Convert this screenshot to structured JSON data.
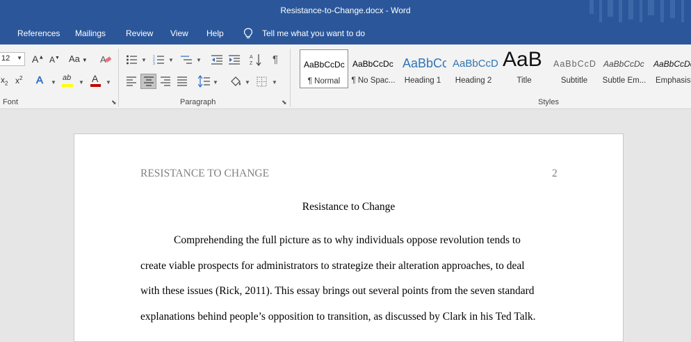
{
  "window": {
    "title": "Resistance-to-Change.docx  -  Word"
  },
  "menu": {
    "items": [
      "References",
      "Mailings",
      "Review",
      "View",
      "Help"
    ],
    "tell_me": "Tell me what you want to do"
  },
  "ribbon": {
    "font": {
      "label": "Font",
      "size": "12",
      "grow": "A",
      "shrink": "A",
      "change_case": "Aa",
      "subscript": "x",
      "superscript": "x",
      "text_effects": "A",
      "highlight": "ab",
      "font_color": "A"
    },
    "paragraph": {
      "label": "Paragraph",
      "pilcrow": "¶"
    },
    "styles": {
      "label": "Styles",
      "items": [
        {
          "preview": "AaBbCcDc",
          "name": "¶ Normal"
        },
        {
          "preview": "AaBbCcDc",
          "name": "¶ No Spac..."
        },
        {
          "preview": "AaBbCc",
          "name": "Heading 1"
        },
        {
          "preview": "AaBbCcD",
          "name": "Heading 2"
        },
        {
          "preview": "AaB",
          "name": "Title"
        },
        {
          "preview": "AaBbCcD",
          "name": "Subtitle"
        },
        {
          "preview": "AaBbCcDc",
          "name": "Subtle Em..."
        },
        {
          "preview": "AaBbCcDc",
          "name": "Emphasis"
        }
      ]
    },
    "colors": {
      "highlight": "#ffff00",
      "font_color": "#c00000"
    }
  },
  "document": {
    "header": "RESISTANCE TO CHANGE",
    "page_number": "2",
    "title": "Resistance to Change",
    "lines": [
      "Comprehending the full picture as to why individuals oppose revolution tends to",
      "create viable prospects for administrators to strategize their alteration approaches, to deal",
      "with these issues (Rick, 2011). This essay brings out several points from the seven standard",
      "explanations behind people’s opposition to transition, as discussed by Clark in his Ted Talk."
    ]
  }
}
